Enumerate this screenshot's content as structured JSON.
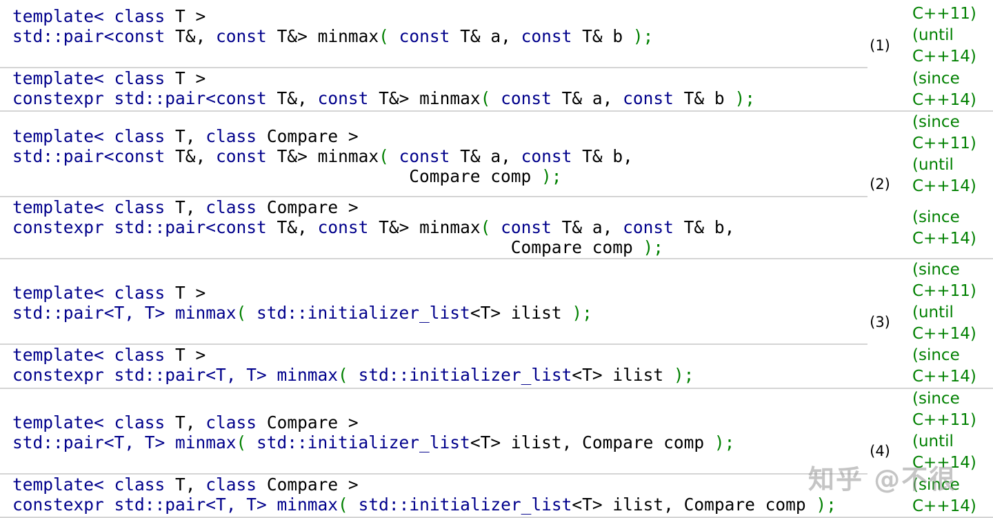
{
  "groups": [
    {
      "number": "(1)",
      "variants": [
        {
          "lines": [
            [
              "template< ",
              "class",
              " T >"
            ],
            [
              "std::pair<",
              "const",
              " T&, ",
              "const",
              " T&> minmax",
              "(",
              " ",
              "const",
              " T& a, ",
              "const",
              " T& b ",
              ");"
            ]
          ],
          "version": [
            "C++11)",
            "(until",
            "C++14)"
          ]
        },
        {
          "lines": [
            [
              "template< ",
              "class",
              " T >"
            ],
            [
              "constexpr",
              " std::pair<",
              "const",
              " T&, ",
              "const",
              " T&> minmax",
              "(",
              " ",
              "const",
              " T& a, ",
              "const",
              " T& b ",
              ");"
            ]
          ],
          "version": [
            "(since",
            "C++14)"
          ]
        }
      ]
    },
    {
      "number": "(2)",
      "variants": [
        {
          "lines": [
            [
              "template< ",
              "class",
              " T, ",
              "class",
              " Compare >"
            ],
            [
              "std::pair<",
              "const",
              " T&, ",
              "const",
              " T&> minmax",
              "(",
              " ",
              "const",
              " T& a, ",
              "const",
              " T& b,"
            ],
            [
              "                                       Compare comp ",
              ");"
            ]
          ],
          "version": [
            "(since",
            "C++11)",
            "(until",
            "C++14)"
          ]
        },
        {
          "lines": [
            [
              "template< ",
              "class",
              " T, ",
              "class",
              " Compare >"
            ],
            [
              "constexpr",
              " std::pair<",
              "const",
              " T&, ",
              "const",
              " T&> minmax",
              "(",
              " ",
              "const",
              " T& a, ",
              "const",
              " T& b,"
            ],
            [
              "                                                 Compare comp ",
              ");"
            ]
          ],
          "version": [
            "(since",
            "C++14)"
          ]
        }
      ]
    },
    {
      "number": "(3)",
      "variants": [
        {
          "lines": [
            [
              "template< ",
              "class",
              " T >"
            ],
            [
              "std::pair<T, T> minmax",
              "(",
              " ",
              "std::initializer_list",
              "<T> ilist ",
              ");"
            ]
          ],
          "version": [
            "(since",
            "C++11)",
            "(until",
            "C++14)"
          ]
        },
        {
          "lines": [
            [
              "template< ",
              "class",
              " T >"
            ],
            [
              "constexpr",
              " std::pair<T, T> minmax",
              "(",
              " ",
              "std::initializer_list",
              "<T> ilist ",
              ");"
            ]
          ],
          "version": [
            "(since",
            "C++14)"
          ]
        }
      ]
    },
    {
      "number": "(4)",
      "variants": [
        {
          "lines": [
            [
              "template< ",
              "class",
              " T, ",
              "class",
              " Compare >"
            ],
            [
              "std::pair<T, T> minmax",
              "(",
              " ",
              "std::initializer_list",
              "<T> ilist, Compare comp ",
              ");"
            ]
          ],
          "version": [
            "(since",
            "C++11)",
            "(until",
            "C++14)"
          ]
        },
        {
          "lines": [
            [
              "template< ",
              "class",
              " T, ",
              "class",
              " Compare >"
            ],
            [
              "constexpr",
              " std::pair<T, T> minmax",
              "(",
              " ",
              "std::initializer_list",
              "<T> ilist, Compare comp ",
              ");"
            ]
          ],
          "version": [
            "(since",
            "C++14)"
          ]
        }
      ]
    }
  ],
  "watermark": "知乎 @不很",
  "colors": {
    "keyword": "#00008b",
    "paren": "#008000",
    "version": "#008000",
    "text": "#000000"
  }
}
